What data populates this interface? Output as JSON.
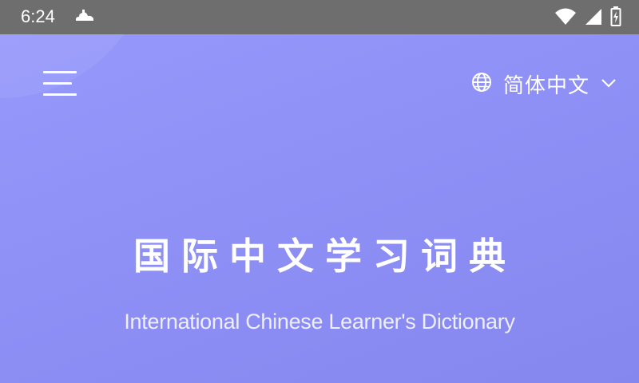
{
  "status_bar": {
    "time": "6:24",
    "icons": [
      "cloud-notification-icon",
      "wifi-icon",
      "signal-icon",
      "battery-icon"
    ]
  },
  "header": {
    "menu_icon": "hamburger-menu-icon",
    "language": {
      "icon": "globe-icon",
      "label": "简体中文",
      "chevron": "chevron-down-icon"
    }
  },
  "hero": {
    "title": "国际中文学习词典",
    "subtitle": "International Chinese Learner's Dictionary"
  },
  "colors": {
    "status_bar": "#6e6e6e",
    "hero_background": "#8e90f6",
    "text": "#ffffff"
  }
}
